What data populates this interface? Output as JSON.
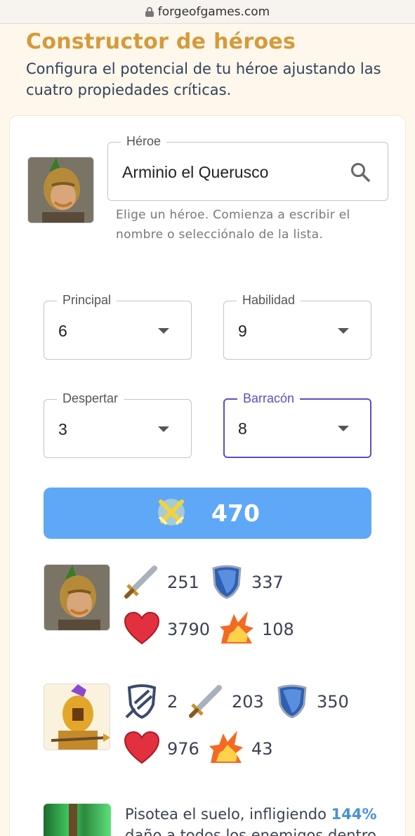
{
  "browser": {
    "url": "forgeofgames.com"
  },
  "header": {
    "title": "Constructor de héroes",
    "subtitle": "Configura el potencial de tu héroe ajustando las cuatro propiedades críticas."
  },
  "hero_select": {
    "label": "Héroe",
    "value": "Arminio el Querusco",
    "helper": "Elige un héroe. Comienza a escribir el nombre o selecciónalo de la lista."
  },
  "selects": [
    {
      "label": "Principal",
      "value": "6"
    },
    {
      "label": "Habilidad",
      "value": "9"
    },
    {
      "label": "Despertar",
      "value": "3"
    },
    {
      "label": "Barracón",
      "value": "8"
    }
  ],
  "power": {
    "value": "470"
  },
  "hero_stats": {
    "attack": "251",
    "defense": "337",
    "health": "3790",
    "damage": "108"
  },
  "unit_stats": {
    "armor": "2",
    "attack": "203",
    "defense": "350",
    "health": "976",
    "damage": "43"
  },
  "skill": {
    "text_before": "Pisotea el suelo, infligiendo ",
    "percent": "144%",
    "text_after": " daño a todos los enemigos dentro"
  },
  "colors": {
    "accent": "#d69a3a",
    "power_button": "#5ea8f7",
    "focus": "#5b4fc7",
    "skill_percent": "#4a90d9"
  }
}
